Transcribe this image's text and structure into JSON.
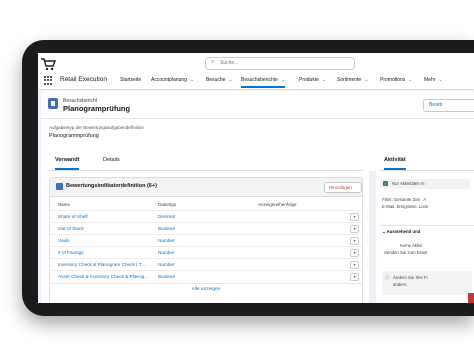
{
  "header": {
    "search_placeholder": "Suche...",
    "app_name": "Retail Execution",
    "nav": [
      {
        "label": "Startseite",
        "dropdown": false
      },
      {
        "label": "Accountplanung",
        "dropdown": true
      },
      {
        "label": "Besuche",
        "dropdown": true
      },
      {
        "label": "Besuchsberichte",
        "dropdown": true,
        "active": true
      },
      {
        "label": "Produkte",
        "dropdown": true
      },
      {
        "label": "Sortimente",
        "dropdown": true
      },
      {
        "label": "Promotions",
        "dropdown": true
      },
      {
        "label": "Mehr",
        "dropdown": true
      }
    ]
  },
  "record": {
    "object_type": "Besuchsbericht",
    "title": "Planogramprüfung",
    "edit_label": "Bearb",
    "field_label": "Aufgabentyp der Bewertungsaufgabendefinition",
    "field_value": "Planogrammprüfung"
  },
  "tabs": [
    "Verwandt",
    "Details"
  ],
  "related_list": {
    "title": "Bewertungsindikatordefinition (6+)",
    "new_label": "Hinzufügen",
    "columns": [
      "Name",
      "Datentyp",
      "Anzeigereihenfolge"
    ],
    "rows": [
      {
        "name": "Share of Shelf",
        "type": "Decimal"
      },
      {
        "name": "Out of Stock",
        "type": "Boolean"
      },
      {
        "name": "Voids",
        "type": "Number"
      },
      {
        "name": "# of Facings",
        "type": "Number"
      },
      {
        "name": "Inventory Check & Planogram Check ( T...",
        "type": "Number"
      },
      {
        "name": "Asset Check & Inventory Check & Planog...",
        "type": "Boolean"
      }
    ],
    "view_all": "Alle anzeigen"
  },
  "activity": {
    "tab": "Aktivität",
    "only_activities": "Nur Aktivitäten m",
    "filter_line1": "Filter: Gesamte Zeit · A",
    "filter_line2": "E-Mail, Ereignisse, Liste",
    "section": "Ausstehend und",
    "empty_line1": "Keine Aktivi",
    "empty_line2": "Senden Sie zum Einsti",
    "info_line1": "Ändern Sie Ihre Fi",
    "info_line2": "ändern."
  },
  "colors": {
    "accent": "#0176d3",
    "icon_blue": "#3b6fb6",
    "device": "#1b1b1d"
  }
}
